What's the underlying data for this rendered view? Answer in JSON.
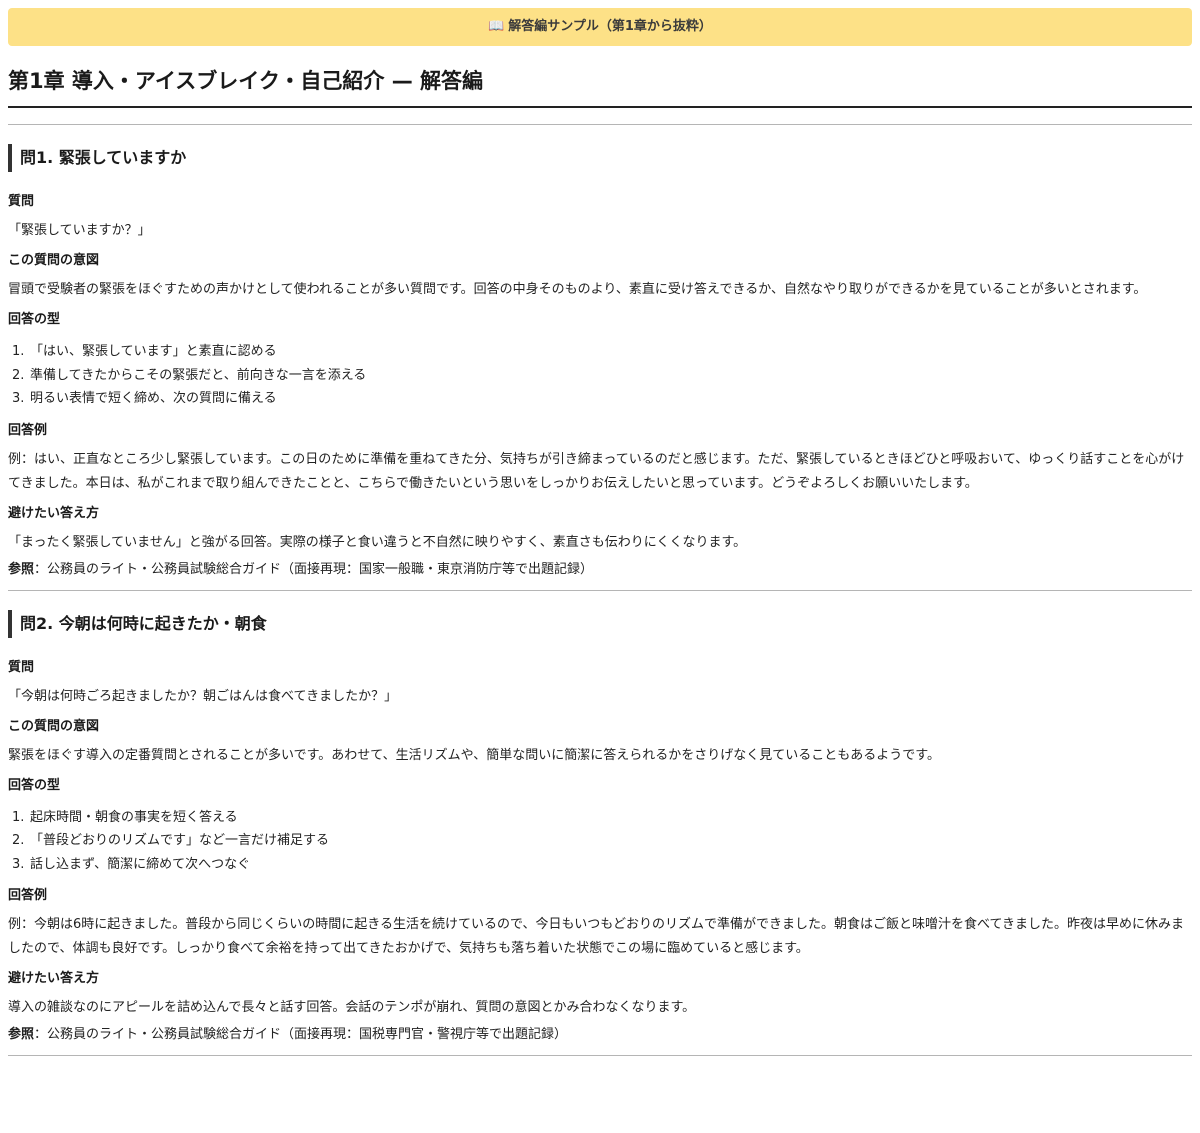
{
  "banner": {
    "icon": "📖",
    "text": "解答編サンプル（第1章から抜粋）"
  },
  "page_title": "第1章 導入・アイスブレイク・自己紹介 — 解答編",
  "questions": [
    {
      "heading": "問1. 緊張していますか",
      "question_label": "質問",
      "question_text": "「緊張していますか？」",
      "intent_label": "この質問の意図",
      "intent_text": "冒頭で受験者の緊張をほぐすための声かけとして使われることが多い質問です。回答の中身そのものより、素直に受け答えできるか、自然なやり取りができるかを見ていることが多いとされます。",
      "pattern_label": "回答の型",
      "steps": [
        {
          "num": "1.",
          "text": "「はい、緊張しています」と素直に認める"
        },
        {
          "num": "2.",
          "text": "準備してきたからこその緊張だと、前向きな一言を添える"
        },
        {
          "num": "3.",
          "text": "明るい表情で短く締め、次の質問に備える"
        }
      ],
      "example_label": "回答例",
      "example_text": "例：はい、正直なところ少し緊張しています。この日のために準備を重ねてきた分、気持ちが引き締まっているのだと感じます。ただ、緊張しているときほどひと呼吸おいて、ゆっくり話すことを心がけてきました。本日は、私がこれまで取り組んできたことと、こちらで働きたいという思いをしっかりお伝えしたいと思っています。どうぞよろしくお願いいたします。",
      "avoid_label": "避けたい答え方",
      "avoid_text": "「まったく緊張していません」と強がる回答。実際の様子と食い違うと不自然に映りやすく、素直さも伝わりにくくなります。",
      "ref_label": "参照",
      "ref_text": "：公務員のライト・公務員試験総合ガイド（面接再現：国家一般職・東京消防庁等で出題記録）"
    },
    {
      "heading": "問2. 今朝は何時に起きたか・朝食",
      "question_label": "質問",
      "question_text": "「今朝は何時ごろ起きましたか？朝ごはんは食べてきましたか？」",
      "intent_label": "この質問の意図",
      "intent_text": "緊張をほぐす導入の定番質問とされることが多いです。あわせて、生活リズムや、簡単な問いに簡潔に答えられるかをさりげなく見ていることもあるようです。",
      "pattern_label": "回答の型",
      "steps": [
        {
          "num": "1.",
          "text": "起床時間・朝食の事実を短く答える"
        },
        {
          "num": "2.",
          "text": "「普段どおりのリズムです」など一言だけ補足する"
        },
        {
          "num": "3.",
          "text": "話し込まず、簡潔に締めて次へつなぐ"
        }
      ],
      "example_label": "回答例",
      "example_text": "例：今朝は6時に起きました。普段から同じくらいの時間に起きる生活を続けているので、今日もいつもどおりのリズムで準備ができました。朝食はご飯と味噌汁を食べてきました。昨夜は早めに休みましたので、体調も良好です。しっかり食べて余裕を持って出てきたおかげで、気持ちも落ち着いた状態でこの場に臨めていると感じます。",
      "avoid_label": "避けたい答え方",
      "avoid_text": "導入の雑談なのにアピールを詰め込んで長々と話す回答。会話のテンポが崩れ、質問の意図とかみ合わなくなります。",
      "ref_label": "参照",
      "ref_text": "：公務員のライト・公務員試験総合ガイド（面接再現：国税専門官・警視庁等で出題記録）"
    }
  ]
}
